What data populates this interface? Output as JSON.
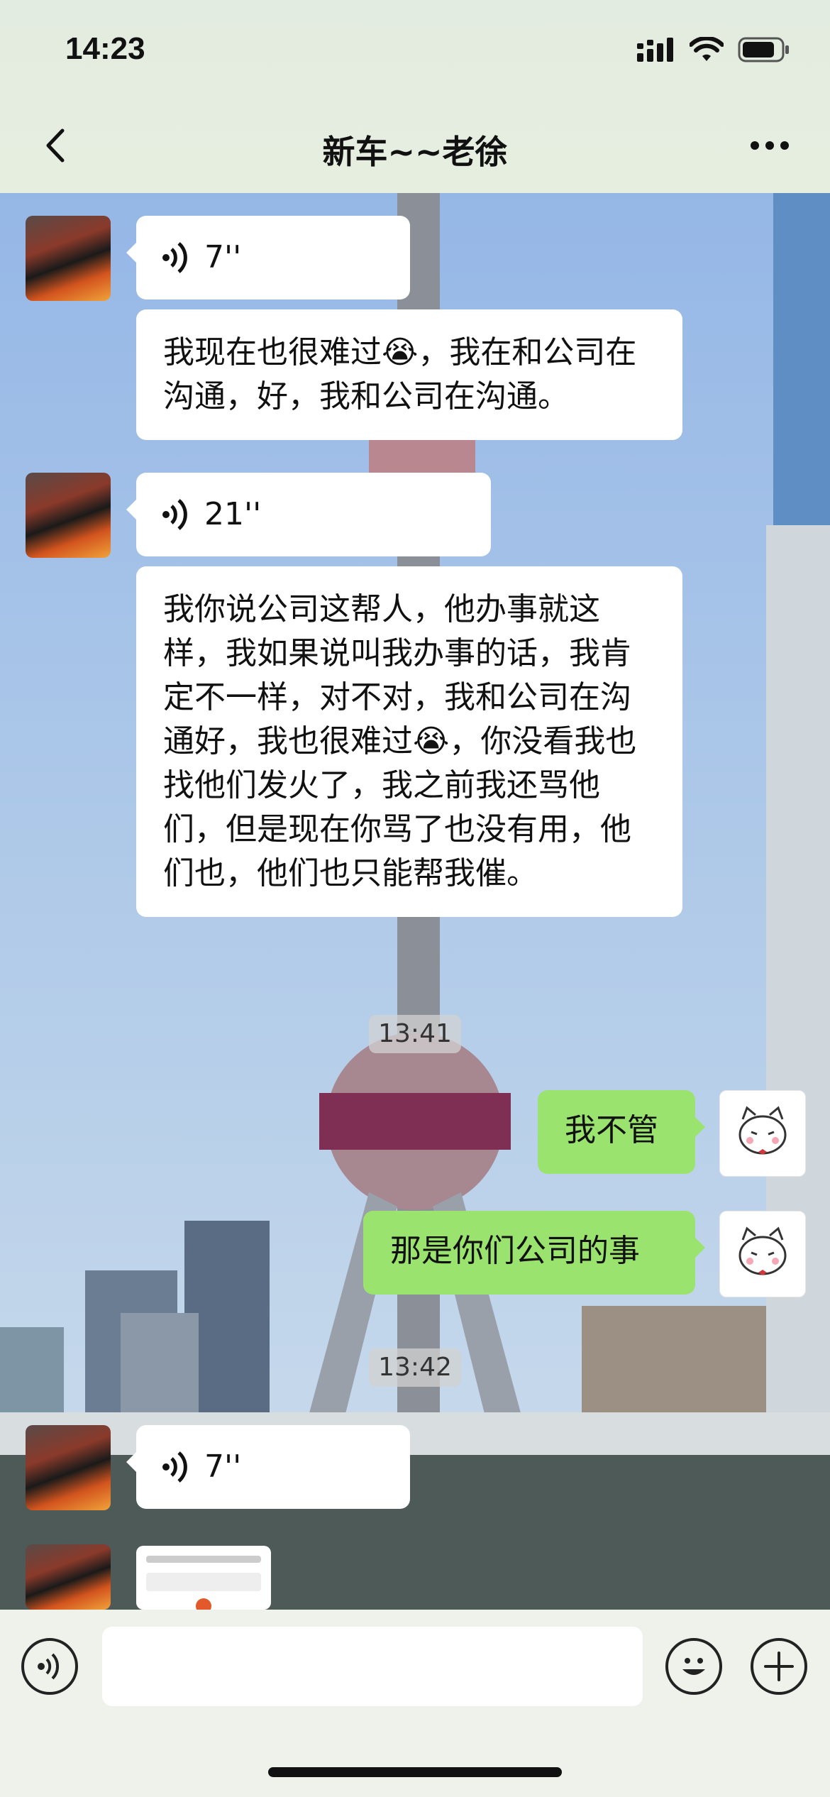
{
  "status_bar": {
    "time": "14:23"
  },
  "header": {
    "title": "新车~~老徐"
  },
  "messages": [
    {
      "voice_duration": "7''"
    },
    {
      "text": "我现在也很难过😭，我在和公司在沟通，好，我和公司在沟通。"
    },
    {
      "voice_duration": "21''"
    },
    {
      "text": "我你说公司这帮人，他办事就这样，我如果说叫我办事的话，我肯定不一样，对不对，我和公司在沟通好，我也很难过😭，你没看我也找他们发火了，我之前我还骂他们，但是现在你骂了也没有用，他们也，他们也只能帮我催。"
    },
    {
      "timestamp": "13:41"
    },
    {
      "text": "我不管"
    },
    {
      "text": "那是你们公司的事"
    },
    {
      "timestamp": "13:42"
    },
    {
      "voice_duration": "7''"
    }
  ],
  "icons": [
    "back-arrow-icon",
    "more-dots-icon",
    "signal-icon",
    "wifi-icon",
    "battery-icon",
    "voice-input-icon",
    "emoji-icon",
    "add-icon"
  ],
  "colors": {
    "sent_bubble": "#9be36f",
    "received_bubble": "#ffffff"
  }
}
